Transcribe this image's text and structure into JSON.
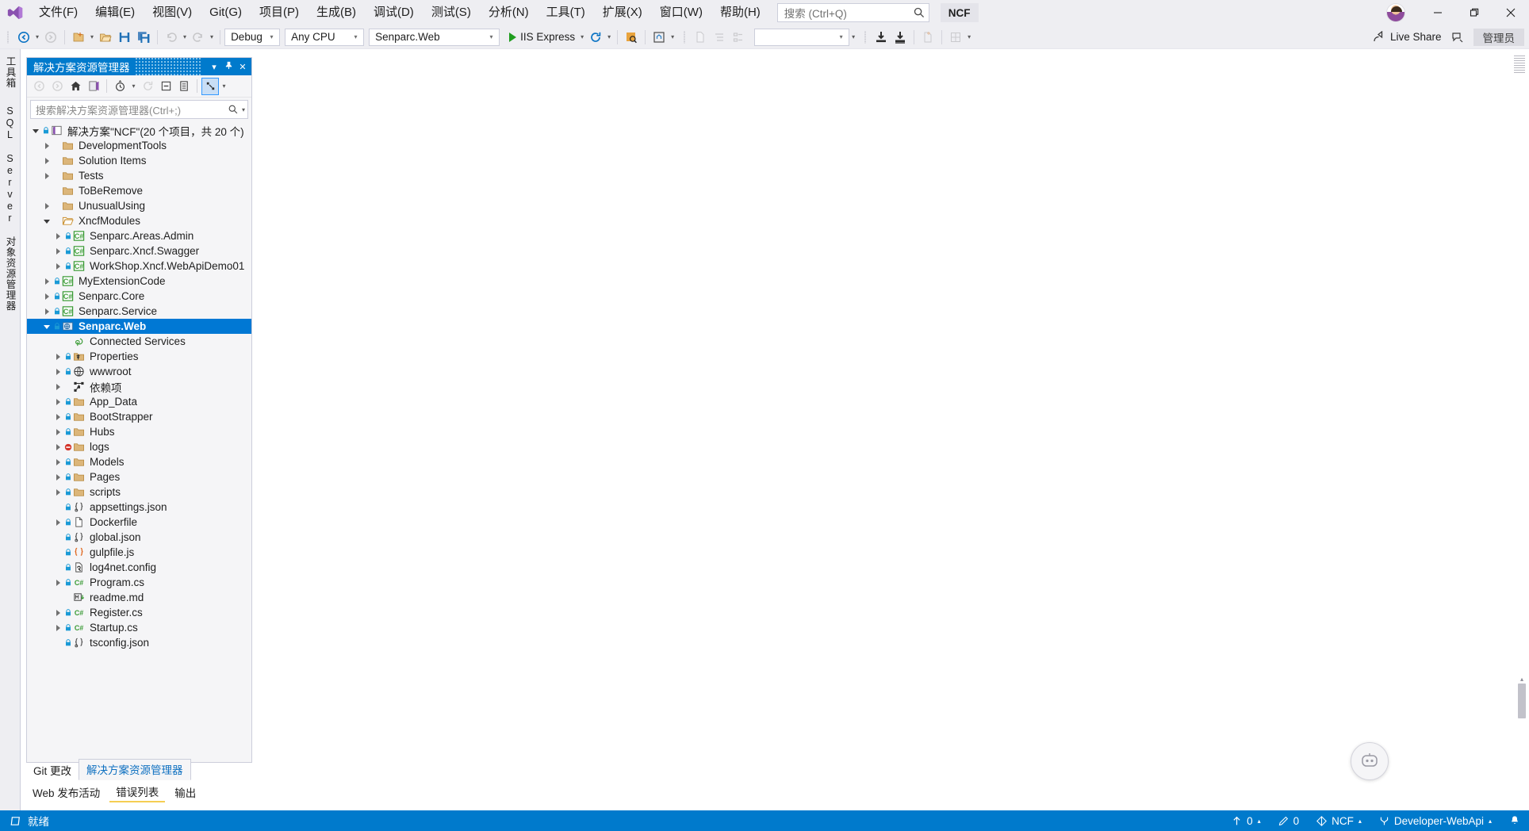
{
  "titlebar": {
    "menu": [
      {
        "label": "文件(F)",
        "name": "menu-file"
      },
      {
        "label": "编辑(E)",
        "name": "menu-edit"
      },
      {
        "label": "视图(V)",
        "name": "menu-view"
      },
      {
        "label": "Git(G)",
        "name": "menu-git"
      },
      {
        "label": "项目(P)",
        "name": "menu-project"
      },
      {
        "label": "生成(B)",
        "name": "menu-build"
      },
      {
        "label": "调试(D)",
        "name": "menu-debug"
      },
      {
        "label": "测试(S)",
        "name": "menu-test"
      },
      {
        "label": "分析(N)",
        "name": "menu-analyze"
      },
      {
        "label": "工具(T)",
        "name": "menu-tools"
      },
      {
        "label": "扩展(X)",
        "name": "menu-extensions"
      },
      {
        "label": "窗口(W)",
        "name": "menu-window"
      },
      {
        "label": "帮助(H)",
        "name": "menu-help"
      }
    ],
    "search_placeholder": "搜索 (Ctrl+Q)",
    "solution_name": "NCF",
    "minimize": "—",
    "maximize": "❐",
    "close": "✕"
  },
  "toolbar": {
    "config": "Debug",
    "platform": "Any CPU",
    "project": "Senparc.Web",
    "run_label": "IIS Express",
    "blank_combo": "",
    "live_share": "Live Share",
    "admin_badge": "管理员"
  },
  "vtabs": {
    "toolbox": "工具箱",
    "server_explorer": "SQL Server 对象资源管理器"
  },
  "solution_explorer": {
    "title": "解决方案资源管理器",
    "search_placeholder": "搜索解决方案资源管理器(Ctrl+;)",
    "pin": "⚲",
    "close": "✕",
    "dropdown": "▾"
  },
  "tree": [
    {
      "label": "解决方案\"NCF\"(20 个项目，共 20 个)",
      "indent": 0,
      "state": "open",
      "icon": "solution",
      "lock": true,
      "selected": false
    },
    {
      "label": "DevelopmentTools",
      "indent": 1,
      "state": "closed",
      "icon": "folder",
      "lock": false,
      "selected": false
    },
    {
      "label": "Solution Items",
      "indent": 1,
      "state": "closed",
      "icon": "folder",
      "lock": false,
      "selected": false
    },
    {
      "label": "Tests",
      "indent": 1,
      "state": "closed",
      "icon": "folder",
      "lock": false,
      "selected": false
    },
    {
      "label": "ToBeRemove",
      "indent": 1,
      "state": "none",
      "icon": "folder",
      "lock": false,
      "selected": false
    },
    {
      "label": "UnusualUsing",
      "indent": 1,
      "state": "closed",
      "icon": "folder",
      "lock": false,
      "selected": false
    },
    {
      "label": "XncfModules",
      "indent": 1,
      "state": "open",
      "icon": "folder-open",
      "lock": false,
      "selected": false
    },
    {
      "label": "Senparc.Areas.Admin",
      "indent": 2,
      "state": "closed",
      "icon": "csproj",
      "lock": true,
      "selected": false
    },
    {
      "label": "Senparc.Xncf.Swagger",
      "indent": 2,
      "state": "closed",
      "icon": "csproj",
      "lock": true,
      "selected": false
    },
    {
      "label": "WorkShop.Xncf.WebApiDemo01",
      "indent": 2,
      "state": "closed",
      "icon": "csproj",
      "lock": true,
      "selected": false
    },
    {
      "label": "MyExtensionCode",
      "indent": 1,
      "state": "closed",
      "icon": "csproj",
      "lock": true,
      "selected": false
    },
    {
      "label": "Senparc.Core",
      "indent": 1,
      "state": "closed",
      "icon": "csproj",
      "lock": true,
      "selected": false
    },
    {
      "label": "Senparc.Service",
      "indent": 1,
      "state": "closed",
      "icon": "csproj",
      "lock": true,
      "selected": false
    },
    {
      "label": "Senparc.Web",
      "indent": 1,
      "state": "open",
      "icon": "webproj",
      "lock": true,
      "selected": true
    },
    {
      "label": "Connected Services",
      "indent": 2,
      "state": "none",
      "icon": "connected",
      "lock": false,
      "selected": false
    },
    {
      "label": "Properties",
      "indent": 2,
      "state": "closed",
      "icon": "properties",
      "lock": true,
      "selected": false
    },
    {
      "label": "wwwroot",
      "indent": 2,
      "state": "closed",
      "icon": "globe",
      "lock": true,
      "selected": false
    },
    {
      "label": "依赖项",
      "indent": 2,
      "state": "closed",
      "icon": "dependencies",
      "lock": false,
      "selected": false
    },
    {
      "label": "App_Data",
      "indent": 2,
      "state": "closed",
      "icon": "folder",
      "lock": true,
      "selected": false
    },
    {
      "label": "BootStrapper",
      "indent": 2,
      "state": "closed",
      "icon": "folder",
      "lock": true,
      "selected": false
    },
    {
      "label": "Hubs",
      "indent": 2,
      "state": "closed",
      "icon": "folder",
      "lock": true,
      "selected": false
    },
    {
      "label": "logs",
      "indent": 2,
      "state": "closed",
      "icon": "folder",
      "lock": "excluded",
      "selected": false
    },
    {
      "label": "Models",
      "indent": 2,
      "state": "closed",
      "icon": "folder",
      "lock": true,
      "selected": false
    },
    {
      "label": "Pages",
      "indent": 2,
      "state": "closed",
      "icon": "folder",
      "lock": true,
      "selected": false
    },
    {
      "label": "scripts",
      "indent": 2,
      "state": "closed",
      "icon": "folder",
      "lock": true,
      "selected": false
    },
    {
      "label": "appsettings.json",
      "indent": 2,
      "state": "none",
      "icon": "json",
      "lock": true,
      "selected": false
    },
    {
      "label": "Dockerfile",
      "indent": 2,
      "state": "closed",
      "icon": "file",
      "lock": true,
      "selected": false
    },
    {
      "label": "global.json",
      "indent": 2,
      "state": "none",
      "icon": "json",
      "lock": true,
      "selected": false
    },
    {
      "label": "gulpfile.js",
      "indent": 2,
      "state": "none",
      "icon": "js",
      "lock": true,
      "selected": false
    },
    {
      "label": "log4net.config",
      "indent": 2,
      "state": "none",
      "icon": "config",
      "lock": true,
      "selected": false
    },
    {
      "label": "Program.cs",
      "indent": 2,
      "state": "closed",
      "icon": "cs",
      "lock": true,
      "selected": false
    },
    {
      "label": "readme.md",
      "indent": 2,
      "state": "none",
      "icon": "md",
      "lock": false,
      "selected": false
    },
    {
      "label": "Register.cs",
      "indent": 2,
      "state": "closed",
      "icon": "cs",
      "lock": true,
      "selected": false
    },
    {
      "label": "Startup.cs",
      "indent": 2,
      "state": "closed",
      "icon": "cs",
      "lock": true,
      "selected": false
    },
    {
      "label": "tsconfig.json",
      "indent": 2,
      "state": "none",
      "icon": "json",
      "lock": true,
      "selected": false
    }
  ],
  "pane_tabs": [
    {
      "label": "Git 更改",
      "active": false
    },
    {
      "label": "解决方案资源管理器",
      "active": true
    }
  ],
  "bottom_tabs": [
    {
      "label": "Web 发布活动",
      "active": false
    },
    {
      "label": "错误列表",
      "active": true
    },
    {
      "label": "输出",
      "active": false
    }
  ],
  "statusbar": {
    "ready": "就绪",
    "outgoing": "0",
    "changes": "0",
    "repo": "NCF",
    "branch": "Developer-WebApi",
    "caret": "▴"
  }
}
